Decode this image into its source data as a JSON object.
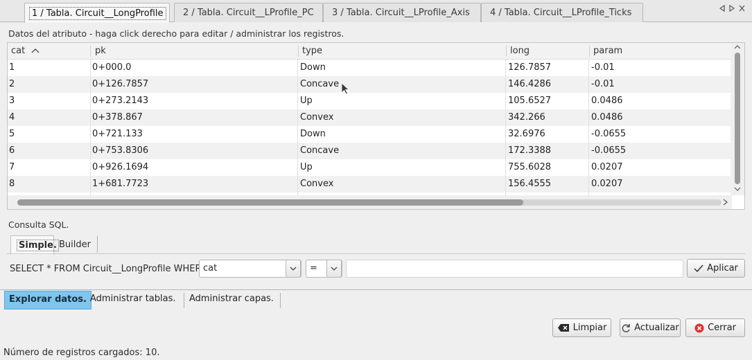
{
  "tabs": [
    {
      "label": "1 / Tabla. Circuit__LongProfile",
      "active": true
    },
    {
      "label": "2 / Tabla. Circuit__LProfile_PC",
      "active": false
    },
    {
      "label": "3 / Tabla. Circuit__LProfile_Axis",
      "active": false
    },
    {
      "label": "4 / Tabla. Circuit__LProfile_Ticks",
      "active": false
    }
  ],
  "tab_nav": {
    "prev_icon": "triangle-left-icon",
    "next_icon": "triangle-right-icon",
    "close_icon": "close-icon"
  },
  "attribute_section": {
    "label": "Datos del atributo - haga click derecho para editar / administrar los registros."
  },
  "table": {
    "columns": [
      "cat",
      "pk",
      "type",
      "long",
      "param"
    ],
    "sort_column": "cat",
    "sort_direction": "ascending",
    "rows": [
      [
        "1",
        "0+000.0",
        "Down",
        "126.7857",
        "-0.01"
      ],
      [
        "2",
        "0+126.7857",
        "Concave",
        "146.4286",
        "-0.01"
      ],
      [
        "3",
        "0+273.2143",
        "Up",
        "105.6527",
        "0.0486"
      ],
      [
        "4",
        "0+378.867",
        "Convex",
        "342.266",
        "0.0486"
      ],
      [
        "5",
        "0+721.133",
        "Down",
        "32.6976",
        "-0.0655"
      ],
      [
        "6",
        "0+753.8306",
        "Concave",
        "172.3388",
        "-0.0655"
      ],
      [
        "7",
        "0+926.1694",
        "Up",
        "755.6028",
        "0.0207"
      ],
      [
        "8",
        "1+681.7723",
        "Convex",
        "156.4555",
        "0.0207"
      ]
    ]
  },
  "sql": {
    "label": "Consulta SQL.",
    "tabs": [
      "Simple.",
      "Builder"
    ],
    "query_prefix": "SELECT * FROM Circuit__LongProfile WHERE",
    "column_value": "cat",
    "operator_value": "=",
    "value_input": "",
    "apply_label": "Aplicar"
  },
  "bottom_tabs": [
    "Explorar datos.",
    "Administrar tablas.",
    "Administrar capas."
  ],
  "actions": {
    "clear_label": "Limpiar",
    "refresh_label": "Actualizar",
    "close_label": "Cerrar"
  },
  "status": {
    "text": "Número de registros cargados: 10."
  },
  "colors": {
    "active_tab_bg": "#7fc6ef",
    "close_red": "#e03030"
  }
}
